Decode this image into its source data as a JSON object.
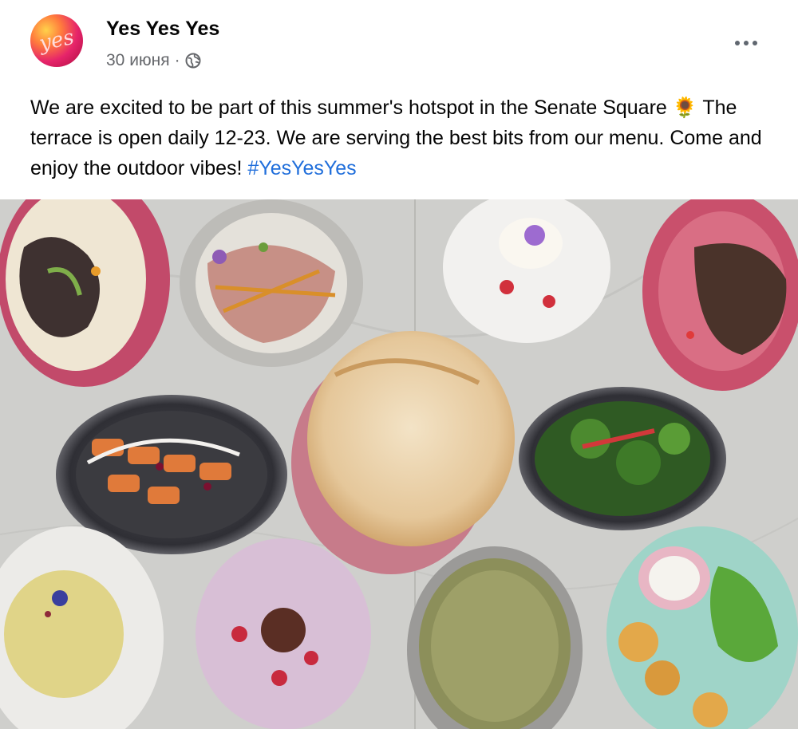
{
  "post": {
    "page_name": "Yes Yes Yes",
    "date": "30 июня",
    "separator": "·",
    "privacy_icon": "globe-icon",
    "more_icon": "more-options-icon",
    "text_main": "We are excited to be part of this summer's hotspot in the Senate Square 🌻 The terrace is open daily 12-23. We are serving the best bits from our menu. Come and enjoy the outdoor vibes! ",
    "hashtag": "#YesYesYes",
    "photo_icon": "food-photo"
  },
  "colors": {
    "hashtag": "#216fdb",
    "meta": "#65676b",
    "text": "#050505"
  }
}
